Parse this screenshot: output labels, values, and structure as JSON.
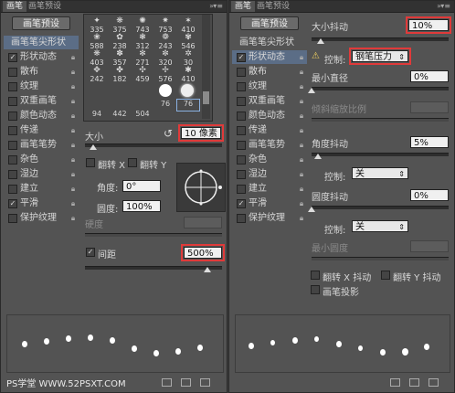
{
  "left": {
    "tabs": [
      "画笔",
      "画笔预设"
    ],
    "preset_button": "画笔预设",
    "sidebar": [
      {
        "label": "画笔笔尖形状",
        "header": true,
        "checked": false,
        "lock": false
      },
      {
        "label": "形状动态",
        "checked": true,
        "lock": true
      },
      {
        "label": "散布",
        "checked": false,
        "lock": true
      },
      {
        "label": "纹理",
        "checked": false,
        "lock": true
      },
      {
        "label": "双重画笔",
        "checked": false,
        "lock": true
      },
      {
        "label": "颜色动态",
        "checked": false,
        "lock": true
      },
      {
        "label": "传递",
        "checked": false,
        "lock": true
      },
      {
        "label": "画笔笔势",
        "checked": false,
        "lock": true
      },
      {
        "label": "杂色",
        "checked": false,
        "lock": true
      },
      {
        "label": "湿边",
        "checked": false,
        "lock": true
      },
      {
        "label": "建立",
        "checked": false,
        "lock": true
      },
      {
        "label": "平滑",
        "checked": true,
        "lock": true
      },
      {
        "label": "保护纹理",
        "checked": false,
        "lock": true
      }
    ],
    "brush_sizes": [
      [
        "335",
        "375",
        "743",
        "753",
        "410"
      ],
      [
        "588",
        "238",
        "312",
        "243",
        "546"
      ],
      [
        "403",
        "357",
        "271",
        "320",
        "30"
      ],
      [
        "242",
        "182",
        "459",
        "576",
        "410"
      ],
      [
        "",
        "",
        "",
        "76",
        "76"
      ],
      [
        "94",
        "442",
        "504",
        "76",
        "76"
      ]
    ],
    "size_label": "大小",
    "size_value": "10 像素",
    "flip_x": "翻转 X",
    "flip_y": "翻转 Y",
    "angle_label": "角度:",
    "angle_value": "0°",
    "roundness_label": "圆度:",
    "roundness_value": "100%",
    "hardness_label": "硬度",
    "spacing_label": "间距",
    "spacing_checked": true,
    "spacing_value": "500%"
  },
  "right": {
    "tabs": [
      "画笔",
      "画笔预设"
    ],
    "preset_button": "画笔预设",
    "sidebar": [
      {
        "label": "画笔笔尖形状",
        "header": true,
        "checked": false,
        "lock": false
      },
      {
        "label": "形状动态",
        "checked": true,
        "lock": true,
        "selected": true
      },
      {
        "label": "散布",
        "checked": false,
        "lock": true
      },
      {
        "label": "纹理",
        "checked": false,
        "lock": true
      },
      {
        "label": "双重画笔",
        "checked": false,
        "lock": true
      },
      {
        "label": "颜色动态",
        "checked": false,
        "lock": true
      },
      {
        "label": "传递",
        "checked": false,
        "lock": true
      },
      {
        "label": "画笔笔势",
        "checked": false,
        "lock": true
      },
      {
        "label": "杂色",
        "checked": false,
        "lock": true
      },
      {
        "label": "湿边",
        "checked": false,
        "lock": true
      },
      {
        "label": "建立",
        "checked": false,
        "lock": true
      },
      {
        "label": "平滑",
        "checked": true,
        "lock": true
      },
      {
        "label": "保护纹理",
        "checked": false,
        "lock": true
      }
    ],
    "size_jitter_label": "大小抖动",
    "size_jitter_value": "10%",
    "control_label": "控制:",
    "control_value_1": "钢笔压力",
    "min_diameter_label": "最小直径",
    "min_diameter_value": "0%",
    "tilt_scale_label": "倾斜缩放比例",
    "angle_jitter_label": "角度抖动",
    "angle_jitter_value": "5%",
    "control_value_2": "关",
    "roundness_jitter_label": "圆度抖动",
    "roundness_jitter_value": "0%",
    "control_value_3": "关",
    "min_roundness_label": "最小圆度",
    "flip_x_jitter": "翻转 X 抖动",
    "flip_y_jitter": "翻转 Y 抖动",
    "brush_projection": "画笔投影"
  },
  "watermark": "PS学堂 WWW.52PSXT.COM"
}
